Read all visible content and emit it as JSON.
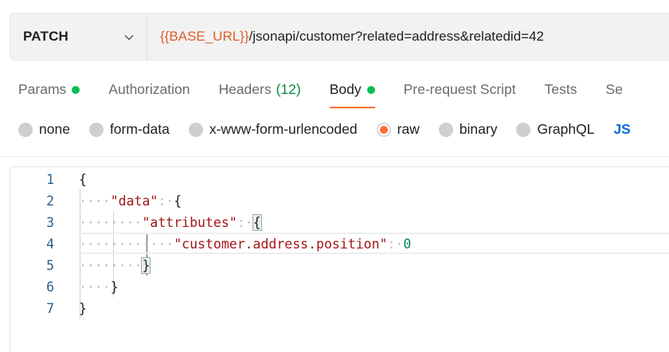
{
  "request": {
    "method": "PATCH",
    "url_variable": "{{BASE_URL}}",
    "url_path": "/jsonapi/customer?related=address&relatedid=42"
  },
  "tabs": [
    {
      "label": "Params",
      "dot": true,
      "count": ""
    },
    {
      "label": "Authorization",
      "dot": false,
      "count": ""
    },
    {
      "label": "Headers",
      "dot": false,
      "count": "(12)"
    },
    {
      "label": "Body",
      "dot": true,
      "count": "",
      "active": true
    },
    {
      "label": "Pre-request Script",
      "dot": false,
      "count": ""
    },
    {
      "label": "Tests",
      "dot": false,
      "count": ""
    },
    {
      "label": "Se",
      "dot": false,
      "count": ""
    }
  ],
  "body_types": {
    "options": [
      "none",
      "form-data",
      "x-www-form-urlencoded",
      "raw",
      "binary",
      "GraphQL"
    ],
    "selected": "raw",
    "format": "JS"
  },
  "editor": {
    "line_numbers": [
      "1",
      "2",
      "3",
      "4",
      "5",
      "6",
      "7"
    ],
    "lines": [
      {
        "indent": "",
        "key": "",
        "sep": "",
        "value": "{"
      },
      {
        "indent": "····",
        "key": "\"data\"",
        "sep": ":·",
        "value": "{"
      },
      {
        "indent": "········",
        "key": "\"attributes\"",
        "sep": ":·",
        "value": "{"
      },
      {
        "indent": "············",
        "key": "\"customer.address.position\"",
        "sep": ":·",
        "value": "0"
      },
      {
        "indent": "········",
        "key": "",
        "sep": "",
        "value": "}"
      },
      {
        "indent": "····",
        "key": "",
        "sep": "",
        "value": "}"
      },
      {
        "indent": "",
        "key": "",
        "sep": "",
        "value": "}"
      }
    ]
  },
  "colors": {
    "accent": "#ff6c37",
    "success_dot": "#0cbb52",
    "url_variable": "#e05c2b",
    "json_key": "#a31515",
    "json_number": "#098658"
  }
}
